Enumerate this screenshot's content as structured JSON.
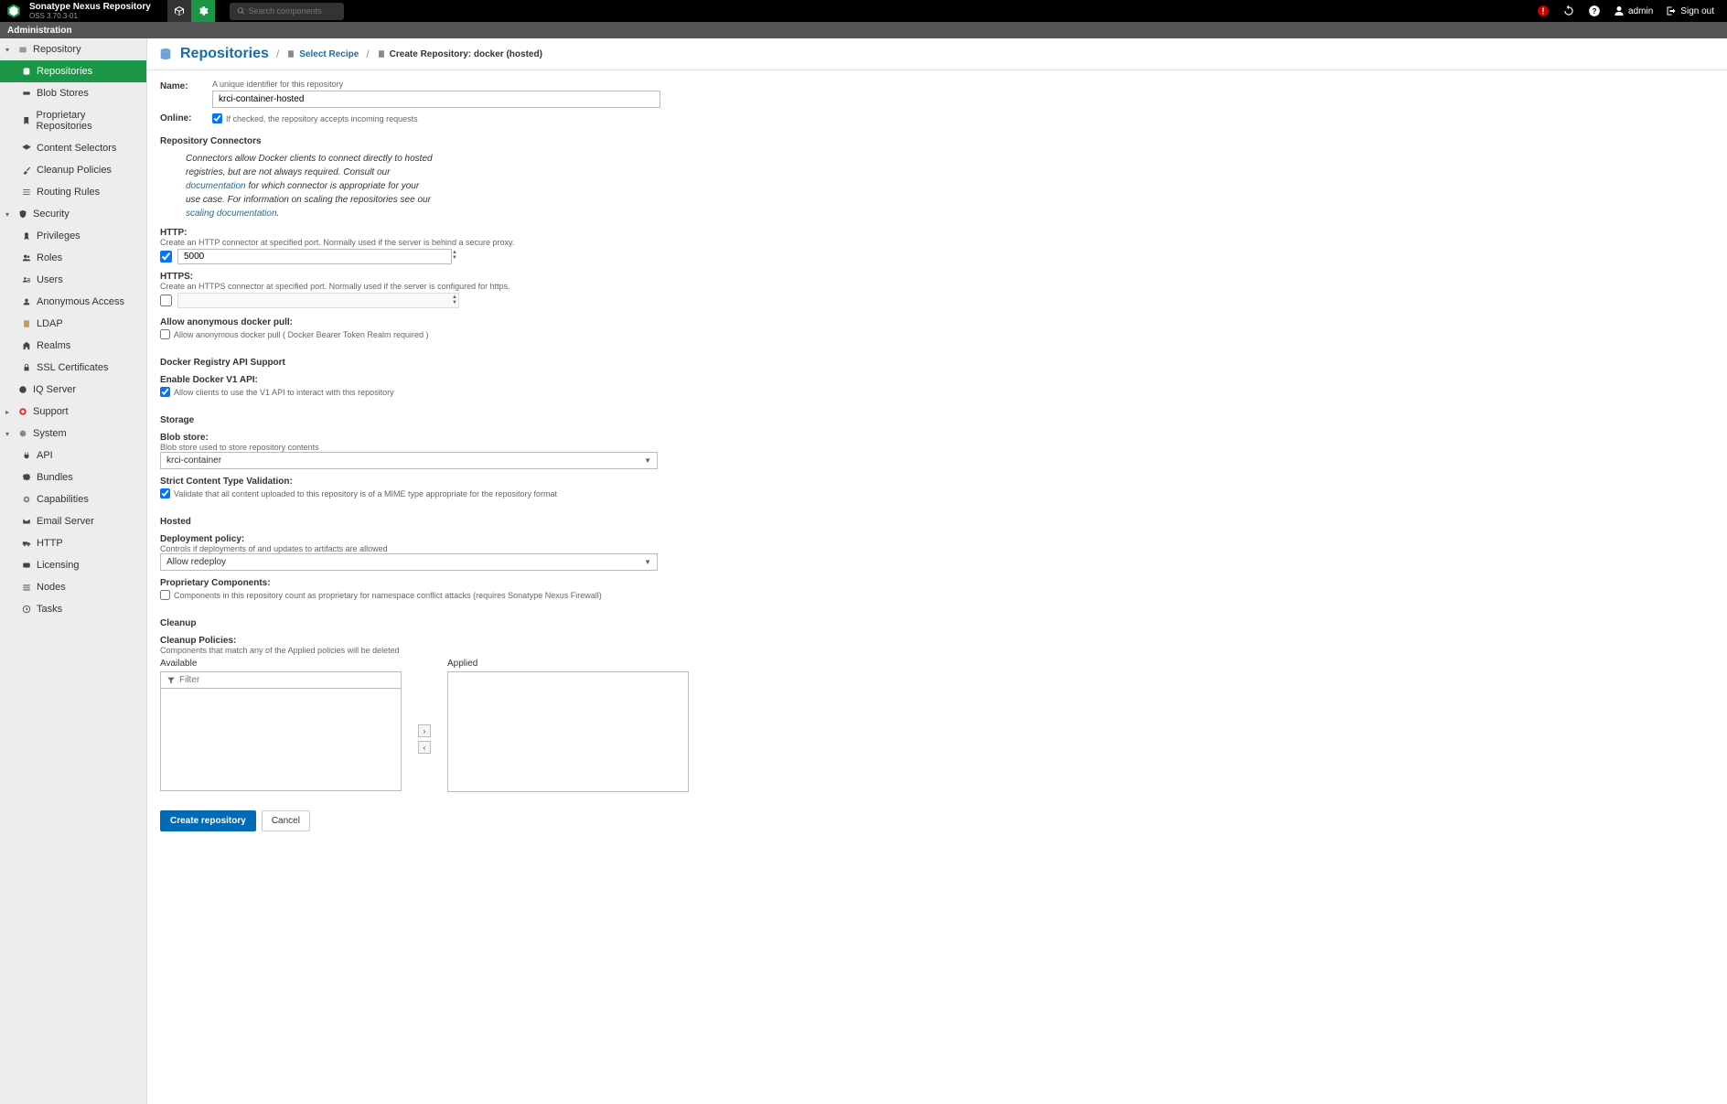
{
  "header": {
    "product_name": "Sonatype Nexus Repository",
    "version": "OSS 3.70.3-01",
    "search_placeholder": "Search components",
    "user": "admin",
    "sign_out": "Sign out"
  },
  "admin_bar": "Administration",
  "sidebar": {
    "repository": {
      "label": "Repository",
      "items": {
        "repositories": "Repositories",
        "blob": "Blob Stores",
        "proprietary": "Proprietary Repositories",
        "content": "Content Selectors",
        "cleanup": "Cleanup Policies",
        "routing": "Routing Rules"
      }
    },
    "security": {
      "label": "Security",
      "items": {
        "privileges": "Privileges",
        "roles": "Roles",
        "users": "Users",
        "anon": "Anonymous Access",
        "ldap": "LDAP",
        "realms": "Realms",
        "ssl": "SSL Certificates"
      }
    },
    "iq": {
      "label": "IQ Server"
    },
    "support": {
      "label": "Support"
    },
    "system": {
      "label": "System",
      "items": {
        "api": "API",
        "bundles": "Bundles",
        "caps": "Capabilities",
        "email": "Email Server",
        "http": "HTTP",
        "licensing": "Licensing",
        "nodes": "Nodes",
        "tasks": "Tasks"
      }
    }
  },
  "breadcrumb": {
    "title": "Repositories",
    "select_recipe": "Select Recipe",
    "current": "Create Repository: docker (hosted)"
  },
  "form": {
    "name": {
      "label": "Name:",
      "hint": "A unique identifier for this repository",
      "value": "krci-container-hosted"
    },
    "online": {
      "label": "Online:",
      "hint": "If checked, the repository accepts incoming requests",
      "checked": true
    },
    "connectors": {
      "heading": "Repository Connectors",
      "info_pre": "Connectors allow Docker clients to connect directly to hosted registries, but are not always required. Consult our ",
      "doc_link": "documentation",
      "info_mid": " for which connector is appropriate for your use case. For information on scaling the repositories see our ",
      "scale_link": "scaling documentation",
      "info_post": ".",
      "http": {
        "label": "HTTP:",
        "hint": "Create an HTTP connector at specified port. Normally used if the server is behind a secure proxy.",
        "value": "5000",
        "checked": true
      },
      "https": {
        "label": "HTTPS:",
        "hint": "Create an HTTPS connector at specified port. Normally used if the server is configured for https.",
        "value": "",
        "checked": false
      },
      "anon": {
        "label": "Allow anonymous docker pull:",
        "option": "Allow anonymous docker pull ( Docker Bearer Token Realm required )",
        "checked": false
      }
    },
    "api": {
      "heading": "Docker Registry API Support",
      "v1label": "Enable Docker V1 API:",
      "v1option": "Allow clients to use the V1 API to interact with this repository",
      "v1checked": true
    },
    "storage": {
      "heading": "Storage",
      "blob": {
        "label": "Blob store:",
        "hint": "Blob store used to store repository contents",
        "value": "krci-container"
      },
      "strict": {
        "label": "Strict Content Type Validation:",
        "option": "Validate that all content uploaded to this repository is of a MIME type appropriate for the repository format",
        "checked": true
      }
    },
    "hosted": {
      "heading": "Hosted",
      "deploy": {
        "label": "Deployment policy:",
        "hint": "Controls if deployments of and updates to artifacts are allowed",
        "value": "Allow redeploy"
      },
      "prop": {
        "label": "Proprietary Components:",
        "option": "Components in this repository count as proprietary for namespace conflict attacks (requires Sonatype Nexus Firewall)",
        "checked": false
      }
    },
    "cleanup": {
      "heading": "Cleanup",
      "policies_label": "Cleanup Policies:",
      "policies_hint": "Components that match any of the Applied policies will be deleted",
      "available": "Available",
      "applied": "Applied",
      "filter_placeholder": "Filter"
    },
    "actions": {
      "create": "Create repository",
      "cancel": "Cancel"
    }
  }
}
